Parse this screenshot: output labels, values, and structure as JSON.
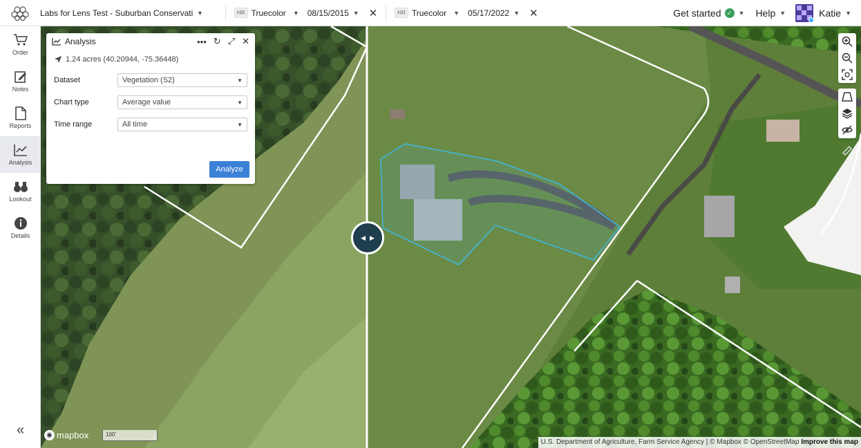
{
  "header": {
    "project_name": "Labs for Lens Test - Suburban Conservati...",
    "layers": [
      {
        "badge": "HR",
        "name": "Truecolor",
        "date": "08/15/2015"
      },
      {
        "badge": "HR",
        "name": "Truecolor",
        "date": "05/17/2022"
      }
    ],
    "get_started": "Get started",
    "help": "Help",
    "user": "Katie"
  },
  "sidebar": {
    "items": [
      {
        "label": "Order",
        "icon": "cart-icon"
      },
      {
        "label": "Notes",
        "icon": "notes-icon"
      },
      {
        "label": "Reports",
        "icon": "reports-icon"
      },
      {
        "label": "Analysis",
        "icon": "chart-line-icon"
      },
      {
        "label": "Lookout",
        "icon": "binoculars-icon"
      },
      {
        "label": "Details",
        "icon": "info-icon"
      }
    ],
    "active": "Analysis"
  },
  "panel": {
    "title": "Analysis",
    "area": "1.24 acres (40.20944, -75.36448)",
    "fields": [
      {
        "label": "Dataset",
        "value": "Vegetation (S2)"
      },
      {
        "label": "Chart type",
        "value": "Average value"
      },
      {
        "label": "Time range",
        "value": "All time"
      }
    ],
    "analyze_label": "Analyze"
  },
  "map": {
    "scale_label": "100'",
    "mapbox_label": "mapbox",
    "attribution": "U.S. Department of Agriculture, Farm Service Agency | © Mapbox © OpenStreetMap",
    "improve_label": "Improve this map"
  },
  "colors": {
    "accent": "#3b82d6",
    "polygon": "#3fb6e0",
    "swipe_handle": "#1f3e4e"
  }
}
